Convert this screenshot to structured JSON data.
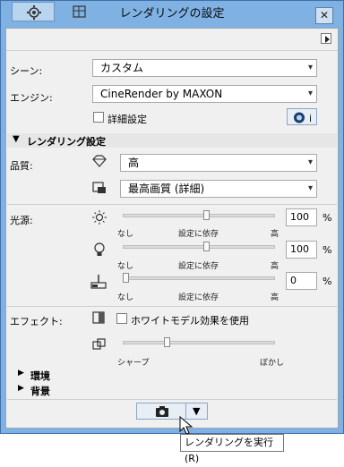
{
  "window": {
    "title": "レンダリングの設定",
    "close_glyph": "✕"
  },
  "tabs": [
    {
      "name": "settings-tab",
      "icon": "gear-icon"
    },
    {
      "name": "view-tab",
      "icon": "grid-icon"
    }
  ],
  "fields": {
    "scene_label": "シーン:",
    "scene_value": "カスタム",
    "engine_label": "エンジン:",
    "engine_value": "CineRender by MAXON",
    "detail_label": "詳細設定"
  },
  "rendering_section": {
    "title": "レンダリング設定",
    "quality_label": "品質:",
    "quality_value": "高",
    "quality2_value": "最高画質 (詳細)"
  },
  "light": {
    "label": "光源:",
    "rows": [
      {
        "value": "100",
        "unit": "%",
        "left": "なし",
        "mid": "設定に依存",
        "right": "高",
        "level": 0.55
      },
      {
        "value": "100",
        "unit": "%",
        "left": "なし",
        "mid": "設定に依存",
        "right": "高",
        "level": 0.55
      },
      {
        "value": "0",
        "unit": "%",
        "left": "なし",
        "mid": "設定に依存",
        "right": "高",
        "level": 0.0
      }
    ]
  },
  "effects": {
    "label": "エフェクト:",
    "white_model_label": "ホワイトモデル効果を使用",
    "left": "シャープ",
    "right": "ぼかし",
    "level": 0.28
  },
  "collapsed": [
    {
      "title": "環境"
    },
    {
      "title": "背景"
    }
  ],
  "tooltip": {
    "text": "レンダリングを実行(R)"
  },
  "colors": {
    "title_bar": "#7fb1e3",
    "panel": "#f0f0f0"
  }
}
